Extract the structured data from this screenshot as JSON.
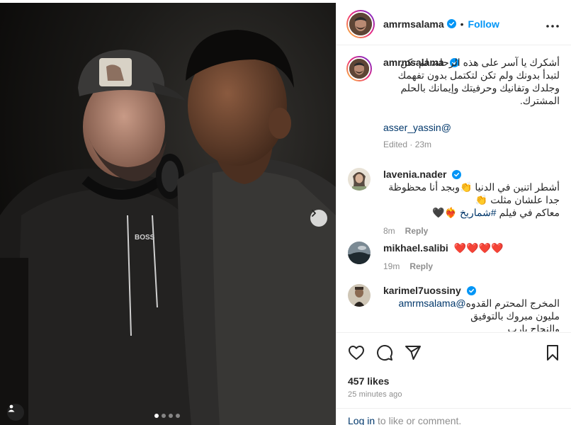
{
  "post": {
    "author": "amrmsalama",
    "follow_label": "Follow",
    "separator": "•",
    "caption": "أشكرك يا آسر على هذه الرحلة، لم تكن لتبدأ بدونك ولم تكن لتكتمل بدون تفهمك وجلدك وتفانيك وحرفيتك وإيمانك بالحلم المشترك.",
    "caption_mention": "asser_yassin@",
    "edited": "Edited · 23m",
    "likes": "457 likes",
    "timestamp": "25 minutes ago",
    "carousel_dots": 4,
    "carousel_active": 0
  },
  "comments": [
    {
      "user": "lavenia.nader",
      "verified": true,
      "text_line1": "أشطر اتنين في الدنيا 👏",
      "text_line2": "وبجد أنا محظوظة جدا علشان مثلت 👏",
      "text_line3_pre": "معاكم في فيلم ",
      "text_line3_tag": "#شماريخ",
      "text_line3_post": " ❤️‍🔥🖤",
      "time": "8m",
      "reply": "Reply"
    },
    {
      "user": "mikhael.salibi",
      "verified": false,
      "text": "❤️❤️❤️❤️",
      "time": "19m",
      "reply": "Reply"
    },
    {
      "user": "karimel7uossiny",
      "verified": true,
      "text_line1": "المخرج المحترم القدوه",
      "text_line2_mention": "amrmsalama@",
      "text_line2_rest": " مليون مبروك بالتوفيق",
      "text_line3": "والنجاح يارب"
    }
  ],
  "footer": {
    "login_link": "Log in",
    "login_rest": " to like or comment."
  },
  "icons": {
    "more": "more-options-icon",
    "like": "heart-icon",
    "comment": "comment-icon",
    "share": "share-icon",
    "save": "bookmark-icon",
    "next": "chevron-right-icon",
    "tag": "user-tag-icon",
    "verified": "verified-badge-icon"
  },
  "colors": {
    "accent": "#0095f6",
    "link": "#00376b",
    "muted": "#8e8e8e",
    "text": "#262626"
  }
}
